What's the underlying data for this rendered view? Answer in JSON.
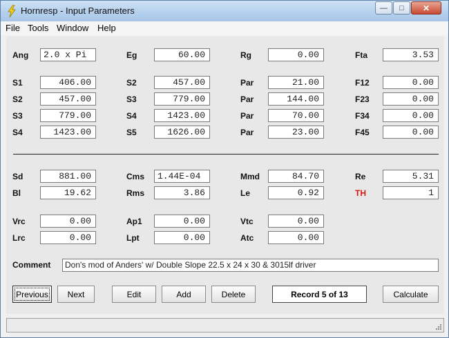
{
  "window": {
    "title": "Hornresp - Input Parameters"
  },
  "menu": {
    "items": [
      "File",
      "Tools",
      "Window",
      "Help"
    ]
  },
  "params": {
    "ang": {
      "label": "Ang",
      "value": "2.0 x Pi"
    },
    "eg": {
      "label": "Eg",
      "value": "60.00"
    },
    "rg": {
      "label": "Rg",
      "value": "0.00"
    },
    "fta": {
      "label": "Fta",
      "value": "3.53"
    },
    "s1": {
      "label": "S1",
      "value": "406.00"
    },
    "s2a": {
      "label": "S2",
      "value": "457.00"
    },
    "par1": {
      "label": "Par",
      "value": "21.00"
    },
    "f12": {
      "label": "F12",
      "value": "0.00"
    },
    "s2b": {
      "label": "S2",
      "value": "457.00"
    },
    "s3a": {
      "label": "S3",
      "value": "779.00"
    },
    "par2": {
      "label": "Par",
      "value": "144.00"
    },
    "f23": {
      "label": "F23",
      "value": "0.00"
    },
    "s3b": {
      "label": "S3",
      "value": "779.00"
    },
    "s4a": {
      "label": "S4",
      "value": "1423.00"
    },
    "par3": {
      "label": "Par",
      "value": "70.00"
    },
    "f34": {
      "label": "F34",
      "value": "0.00"
    },
    "s4b": {
      "label": "S4",
      "value": "1423.00"
    },
    "s5": {
      "label": "S5",
      "value": "1626.00"
    },
    "par4": {
      "label": "Par",
      "value": "23.00"
    },
    "f45": {
      "label": "F45",
      "value": "0.00"
    },
    "sd": {
      "label": "Sd",
      "value": "881.00"
    },
    "cms": {
      "label": "Cms",
      "value": "1.44E-04"
    },
    "mmd": {
      "label": "Mmd",
      "value": "84.70"
    },
    "re": {
      "label": "Re",
      "value": "5.31"
    },
    "bl": {
      "label": "Bl",
      "value": "19.62"
    },
    "rms": {
      "label": "Rms",
      "value": "3.86"
    },
    "le": {
      "label": "Le",
      "value": "0.92"
    },
    "th": {
      "label": "TH",
      "value": "1"
    },
    "vrc": {
      "label": "Vrc",
      "value": "0.00"
    },
    "ap1": {
      "label": "Ap1",
      "value": "0.00"
    },
    "vtc": {
      "label": "Vtc",
      "value": "0.00"
    },
    "lrc": {
      "label": "Lrc",
      "value": "0.00"
    },
    "lpt": {
      "label": "Lpt",
      "value": "0.00"
    },
    "atc": {
      "label": "Atc",
      "value": "0.00"
    }
  },
  "comment": {
    "label": "Comment",
    "value": "Don's mod of Anders' w/ Double Slope 22.5 x 24 x 30 & 3015lf driver"
  },
  "buttons": {
    "previous": "Previous",
    "next": "Next",
    "edit": "Edit",
    "add": "Add",
    "delete": "Delete",
    "record": "Record 5 of 13",
    "calculate": "Calculate"
  },
  "colors": {
    "th_label": "#d21a10",
    "titlebar": "#b8d2ee"
  }
}
